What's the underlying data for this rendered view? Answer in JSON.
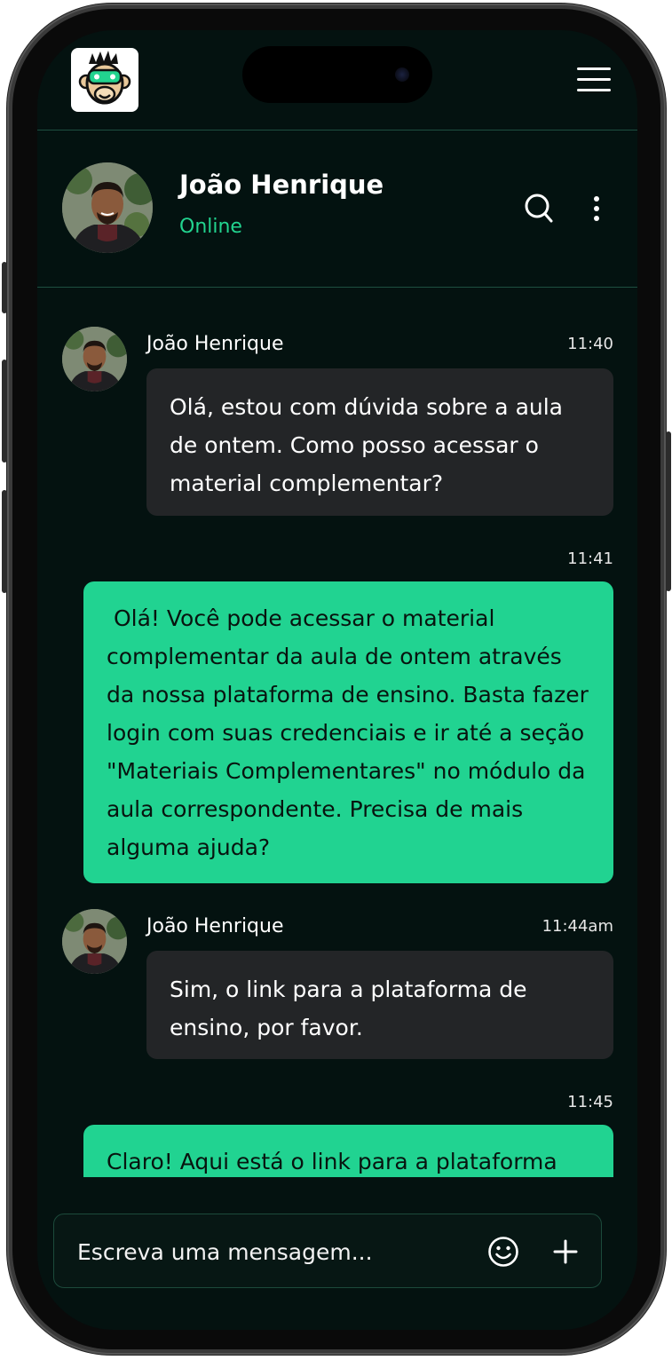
{
  "app": {
    "logo_icon": "monkey-gamer-logo",
    "menu_icon": "hamburger-menu-icon"
  },
  "contact": {
    "name": "João Henrique",
    "status": "Online"
  },
  "messages": [
    {
      "direction": "incoming",
      "sender": "João Henrique",
      "time": "11:40",
      "text": "Olá, estou com dúvida sobre a aula de ontem. Como posso acessar o material complementar?"
    },
    {
      "direction": "outgoing",
      "time": "11:41",
      "text": " Olá! Você pode acessar o material complementar da aula de ontem através da nossa plataforma de ensino. Basta fazer login com suas credenciais e ir até a seção \"Materiais Complementares\" no módulo da aula correspondente. Precisa de mais alguma ajuda?"
    },
    {
      "direction": "incoming",
      "sender": "João Henrique",
      "time": "11:44am",
      "text": "Sim, o link para a plataforma de ensino, por favor."
    },
    {
      "direction": "outgoing",
      "time": "11:45",
      "text": "Claro! Aqui está o link para a plataforma de"
    }
  ],
  "composer": {
    "placeholder": "Escreva uma mensagem..."
  },
  "colors": {
    "background": "#041210",
    "accent": "#21d391",
    "incoming_bubble": "#232527",
    "divider": "#1e4f40"
  }
}
